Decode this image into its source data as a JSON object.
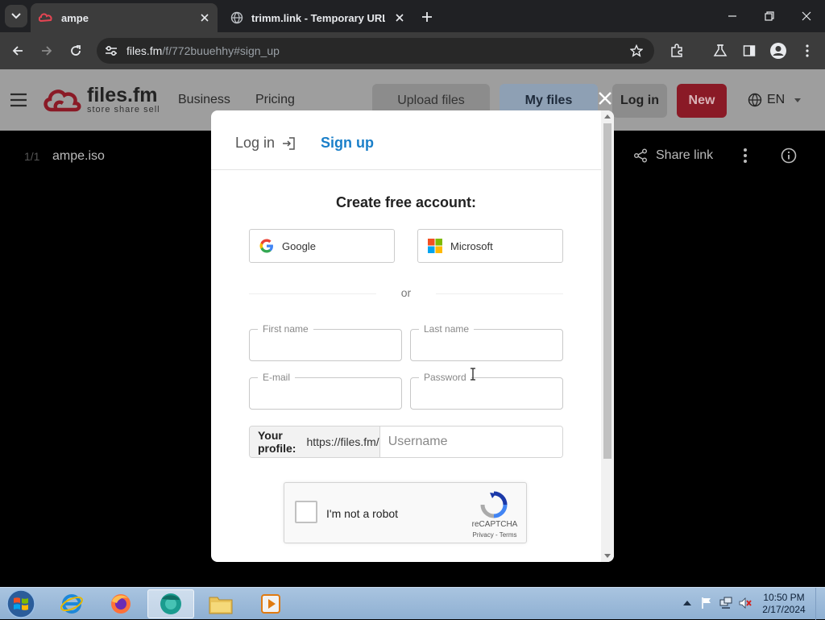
{
  "browser": {
    "tabs": [
      {
        "title": "ampe",
        "active": true
      },
      {
        "title": "trimm.link - Temporary URL sh",
        "active": false
      }
    ],
    "url_host": "files.fm",
    "url_path": "/f/772buuehhy#sign_up"
  },
  "site": {
    "brand_name": "files.fm",
    "brand_tagline": "store share sell",
    "nav": {
      "business": "Business",
      "pricing": "Pricing"
    },
    "buttons": {
      "upload": "Upload files",
      "my_files": "My files",
      "login": "Log in",
      "new": "New"
    },
    "language": "EN",
    "file_counter": "1/1",
    "file_name": "ampe.iso",
    "share_link": "Share link"
  },
  "modal": {
    "tab_login": "Log in",
    "tab_signup": "Sign up",
    "title": "Create free account:",
    "google": "Google",
    "microsoft": "Microsoft",
    "or": "or",
    "fields": {
      "first_name": "First name",
      "last_name": "Last name",
      "email": "E-mail",
      "password": "Password"
    },
    "profile_label": "Your profile:",
    "profile_prefix": "https://files.fm/",
    "username_placeholder": "Username",
    "captcha": {
      "label": "I'm not a robot",
      "brand": "reCAPTCHA",
      "terms": "Privacy - Terms"
    }
  },
  "taskbar": {
    "time": "10:50 PM",
    "date": "2/17/2024"
  },
  "colors": {
    "accent_blue": "#1a7fc9",
    "new_button": "#8a1a26",
    "tab_bar": "#202124"
  }
}
